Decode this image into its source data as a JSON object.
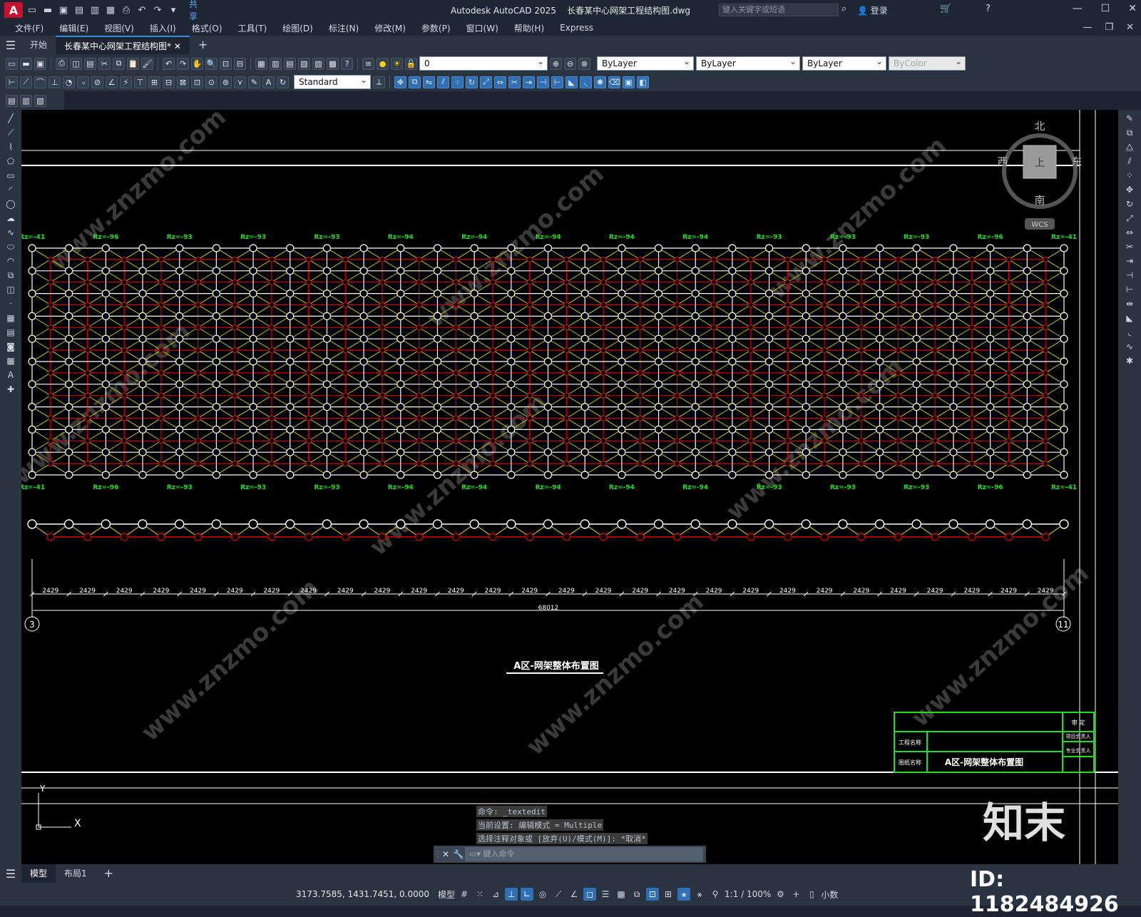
{
  "app": {
    "logo": "A",
    "title": "Autodesk AutoCAD 2025",
    "file": "长春某中心网架工程结构图.dwg",
    "search_placeholder": "键入关键字或短语",
    "login": "登录",
    "share": "共享"
  },
  "menu": [
    "文件(F)",
    "编辑(E)",
    "视图(V)",
    "插入(I)",
    "格式(O)",
    "工具(T)",
    "绘图(D)",
    "标注(N)",
    "修改(M)",
    "参数(P)",
    "窗口(W)",
    "帮助(H)",
    "Express"
  ],
  "tabs": {
    "start": "开始",
    "doc": "长春某中心网架工程结构图*",
    "add": "+"
  },
  "props": {
    "layer": "0",
    "style": "Standard",
    "color": "ByLayer",
    "linetype": "ByLayer",
    "lineweight": "ByLayer",
    "plotstyle": "ByColor"
  },
  "viewcube": {
    "n": "北",
    "s": "南",
    "e": "东",
    "w": "西",
    "top": "上",
    "wcs": "WCS"
  },
  "drawing": {
    "rz_top": [
      "Rz=-41",
      "Rz=-96",
      "Rz=-93",
      "Rz=-93",
      "Rz=-93",
      "Rz=-94",
      "Rz=-94",
      "Rz=-94",
      "Rz=-94",
      "Rz=-94",
      "Rz=-93",
      "Rz=-93",
      "Rz=-93",
      "Rz=-96",
      "Rz=-41"
    ],
    "rz_bottom": [
      "Rz=-41",
      "Rz=-96",
      "Rz=-93",
      "Rz=-93",
      "Rz=-93",
      "Rz=-94",
      "Rz=-94",
      "Rz=-94",
      "Rz=-94",
      "Rz=-94",
      "Rz=-93",
      "Rz=-93",
      "Rz=-93",
      "Rz=-96",
      "Rz=-41"
    ],
    "dim_value": "2429",
    "dim_count": 28,
    "dim_total": "68012",
    "axis_left": "3",
    "axis_right": "11",
    "plan_title": "A区-网架整体布置图",
    "titleblock": {
      "project_label": "工程名称",
      "drawing_label": "图纸名称",
      "drawing_name": "A区-网架整体布置图",
      "review": "审 定",
      "manager": "项目负责人",
      "specialist": "专业负责人"
    },
    "ucs": {
      "x": "X",
      "y": "Y"
    },
    "watermark": "www.znzmo.com",
    "brand": "知末"
  },
  "command": {
    "hist": [
      "命令: _textedit",
      "当前设置: 编辑模式 = Multiple",
      "选择注释对象或 [放弃(U)/模式(M)]: *取消*"
    ],
    "placeholder": "键入命令"
  },
  "layouts": {
    "model": "模型",
    "layout1": "布局1",
    "add": "+"
  },
  "status": {
    "coords": "3173.7585, 1431.7451, 0.0000",
    "space": "模型",
    "scale": "1:1 / 100%",
    "units": "小数"
  },
  "id_label": "ID: 1182484926",
  "colors": {
    "white": "#ffffff",
    "red": "#d40000",
    "yellow": "#e6e600",
    "green": "#22dd22"
  }
}
